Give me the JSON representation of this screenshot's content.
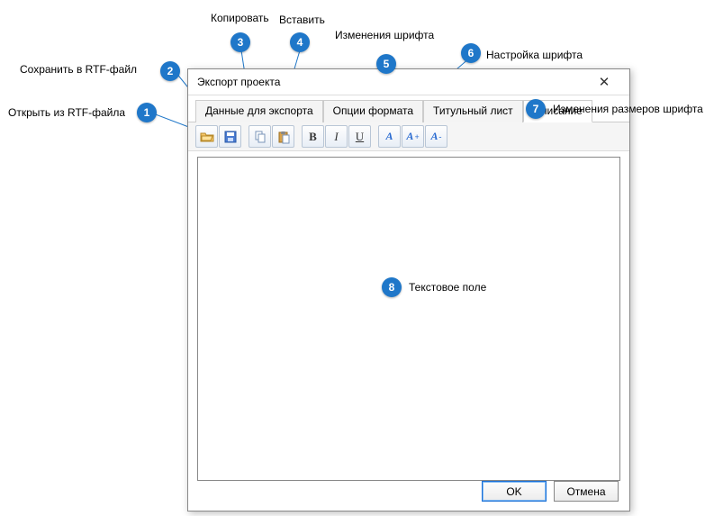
{
  "dialog": {
    "title": "Экспорт проекта",
    "tabs": [
      "Данные для экспорта",
      "Опции формата",
      "Титульный лист",
      "Описание"
    ],
    "active_tab": 3,
    "textarea_value": "",
    "ok_label": "OK",
    "cancel_label": "Отмена"
  },
  "toolbar": {
    "open_rtf": "open-rtf",
    "save_rtf": "save-rtf",
    "copy": "copy",
    "paste": "paste",
    "bold": "B",
    "italic": "I",
    "underline": "U",
    "font_dialog": "A",
    "font_increase": "A+",
    "font_decrease": "A-"
  },
  "callouts": [
    {
      "n": 1,
      "label": "Открыть из RTF-файла"
    },
    {
      "n": 2,
      "label": "Сохранить в RTF-файл"
    },
    {
      "n": 3,
      "label": "Копировать"
    },
    {
      "n": 4,
      "label": "Вставить"
    },
    {
      "n": 5,
      "label": "Изменения шрифта"
    },
    {
      "n": 6,
      "label": "Настройка шрифта"
    },
    {
      "n": 7,
      "label": "Изменения размеров шрифта"
    },
    {
      "n": 8,
      "label": "Текстовое поле"
    }
  ]
}
